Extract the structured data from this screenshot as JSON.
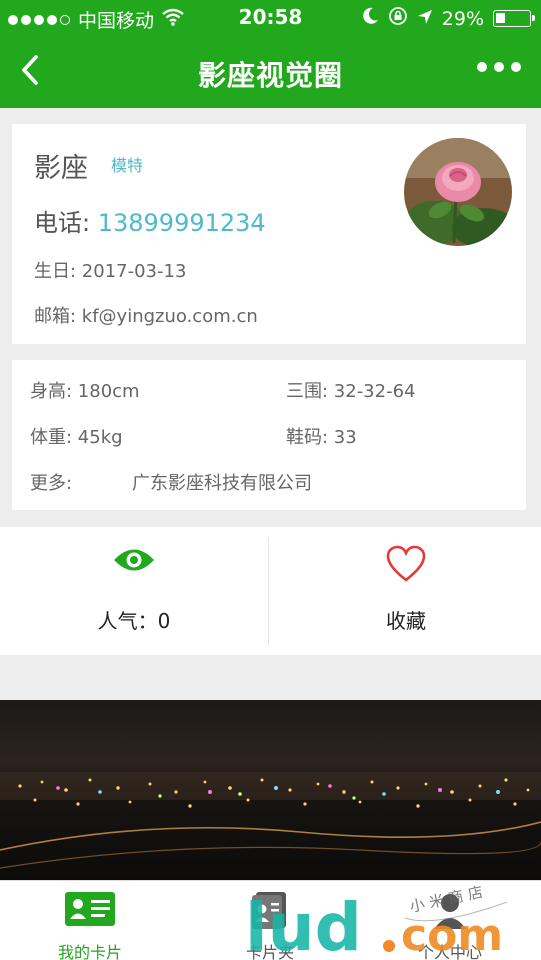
{
  "status_bar": {
    "carrier": "中国移动",
    "time": "20:58",
    "battery": "29%",
    "signal_icon": "signal-dots-icon",
    "wifi_icon": "wifi-icon"
  },
  "nav": {
    "title": "影座视觉圈",
    "back_icon": "chevron-left-icon",
    "more_icon": "more-dots-icon"
  },
  "profile": {
    "name": "影座",
    "role": "模特",
    "phone_label": "电话: ",
    "phone": "13899991234",
    "birthday": "生日: 2017-03-13",
    "email": "邮箱: kf@yingzuo.com.cn"
  },
  "details": {
    "height": "身高: 180cm",
    "measurements": "三围: 32-32-64",
    "weight": "体重: 45kg",
    "shoe_size": "鞋码: 33",
    "more_label": "更多:",
    "more_value": "广东影座科技有限公司"
  },
  "stats": {
    "popularity": "人气：0",
    "favorite": "收藏"
  },
  "tabs": [
    {
      "label": "我的卡片",
      "icon": "card-icon",
      "active": true
    },
    {
      "label": "卡片夹",
      "icon": "card-folder-icon",
      "active": false
    },
    {
      "label": "个人中心",
      "icon": "user-icon",
      "active": false
    }
  ],
  "watermark": {
    "text": "lud.com",
    "script": "小 米 商 店"
  },
  "colors": {
    "brand_green": "#21a81c",
    "link_teal": "#4fb9cb",
    "heart_red": "#e53935"
  }
}
